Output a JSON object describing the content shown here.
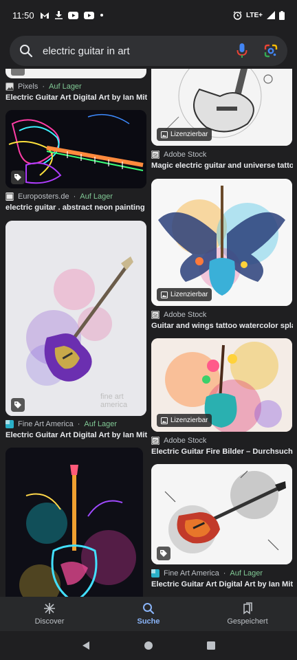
{
  "status": {
    "time": "11:50",
    "network": "LTE+"
  },
  "search": {
    "query": "electric guitar in art"
  },
  "results": {
    "left": [
      {
        "source": "Pixels",
        "stock": "Auf Lager",
        "title": "Electric Guitar Art Digital Art by Ian Mitch..."
      },
      {
        "source": "Europosters.de",
        "stock": "Auf Lager",
        "title": "electric guitar . abstract neon painting Fot..."
      },
      {
        "source": "Fine Art America",
        "stock": "Auf Lager",
        "title": "Electric Guitar Art Digital Art by Ian Mitch...",
        "watermark": "fine art america"
      },
      {
        "source": "",
        "title": ""
      }
    ],
    "right": [
      {
        "badge": "Lizenzierbar",
        "source": "Adobe Stock",
        "title": "Magic electric guitar and universe tattoo. ..."
      },
      {
        "badge": "Lizenzierbar",
        "source": "Adobe Stock",
        "title": "Guitar and wings tattoo watercolor splash..."
      },
      {
        "badge": "Lizenzierbar",
        "source": "Adobe Stock",
        "title": "Electric Guitar Fire Bilder – Durchsuchen ..."
      },
      {
        "source": "Fine Art America",
        "stock": "Auf Lager",
        "title": "Electric Guitar Art Digital Art by Ian Mitch..."
      }
    ]
  },
  "nav": {
    "discover": "Discover",
    "search": "Suche",
    "saved": "Gespeichert"
  },
  "colors": {
    "background": "#1f1f21",
    "accent": "#8ab4f8",
    "stock": "#81c995"
  }
}
